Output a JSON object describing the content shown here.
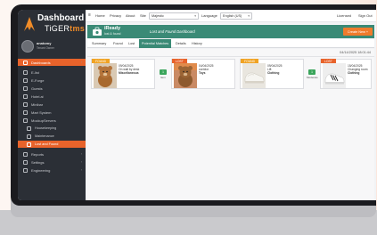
{
  "app": {
    "name_line1": "Dashboard",
    "name_line2_a": "TiGER",
    "name_line2_b": "tms"
  },
  "user": {
    "name": "anatomy",
    "role": "Tenant Owner"
  },
  "sidebar": {
    "items": [
      {
        "label": "Dashboards",
        "icon": "dashboard-icon",
        "active": true
      },
      {
        "label": "E-list",
        "icon": "list-icon"
      },
      {
        "label": "E-Forge",
        "icon": "forge-icon"
      },
      {
        "label": "Guests",
        "icon": "guests-icon"
      },
      {
        "label": "Hotel.ai",
        "icon": "hotel-icon"
      },
      {
        "label": "Minibar",
        "icon": "minibar-icon"
      },
      {
        "label": "Mart System",
        "icon": "mart-icon"
      },
      {
        "label": "MockupServers",
        "icon": "server-icon"
      }
    ],
    "sub_items": [
      {
        "label": "Housekeeping",
        "icon": "housekeeping-icon"
      },
      {
        "label": "Maintenance",
        "icon": "maintenance-icon"
      },
      {
        "label": "Lost and Found",
        "icon": "lost-found-icon",
        "current": true
      }
    ],
    "bottom_items": [
      {
        "label": "Reports",
        "icon": "reports-icon"
      },
      {
        "label": "Settings",
        "icon": "settings-icon"
      },
      {
        "label": "Engineering",
        "icon": "engineering-icon"
      }
    ]
  },
  "topbar": {
    "links": [
      "Home",
      "Privacy",
      "About",
      "Site"
    ],
    "site_value": "Majestic",
    "language_label": "Language",
    "language_value": "English (US)",
    "right_links": [
      "Licensed",
      "Sign Out"
    ]
  },
  "header": {
    "brand_line1": "iReady",
    "brand_line2": "lost & found",
    "title": "Lost and Found Dashboard",
    "create_button": "Create New +"
  },
  "tabs": [
    {
      "label": "Summary"
    },
    {
      "label": "Found"
    },
    {
      "label": "Lost"
    },
    {
      "label": "Potential Matches",
      "active": true
    },
    {
      "label": "Details"
    },
    {
      "label": "History"
    }
  ],
  "timestamp": "04/14/2025 18:01:44",
  "pairs": [
    {
      "left": {
        "tag": "FOUND",
        "kind": "found",
        "image": "teddy-bear",
        "date": "09/04/2025",
        "location": "On wall by desk",
        "category": "Miscellaneous"
      },
      "match": {
        "badge": "1",
        "label": "Item"
      },
      "right": {
        "tag": "LOST",
        "kind": "lost",
        "image": "teddy-bear",
        "date": "04/04/2025",
        "location": "corridor",
        "category": "Toys"
      }
    },
    {
      "left": {
        "tag": "FOUND",
        "kind": "found",
        "image": "sneakers",
        "date": "09/04/2025",
        "location": "Lift",
        "category": "Clothing"
      },
      "match": {
        "badge": "1",
        "label": "Moderate"
      },
      "right": {
        "tag": "LOST",
        "kind": "lost",
        "image": "sneakers",
        "date": "15/04/2025",
        "location": "Changing room",
        "category": "Clothing"
      }
    }
  ],
  "colors": {
    "accent": "#e8632b",
    "header": "#3a8a76",
    "found_tag": "#f0a324",
    "match_badge": "#3aa55b"
  }
}
